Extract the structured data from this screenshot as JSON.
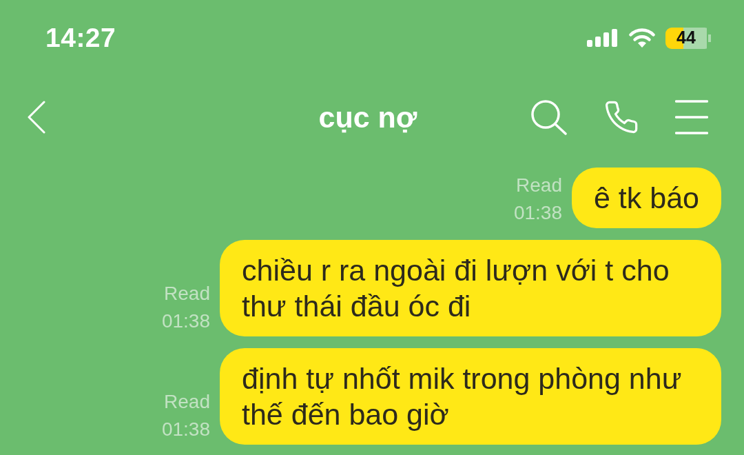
{
  "status_bar": {
    "time": "14:27",
    "battery": "44"
  },
  "header": {
    "title": "cục nợ"
  },
  "messages": [
    {
      "text": "ê tk báo",
      "read_label": "Read",
      "time": "01:38"
    },
    {
      "text": "chiều r ra ngoài đi lượn với t cho thư thái đầu óc đi",
      "read_label": "Read",
      "time": "01:38"
    },
    {
      "text": "định tự nhốt mik trong phòng như thế đến bao giờ",
      "read_label": "Read",
      "time": "01:38"
    }
  ]
}
